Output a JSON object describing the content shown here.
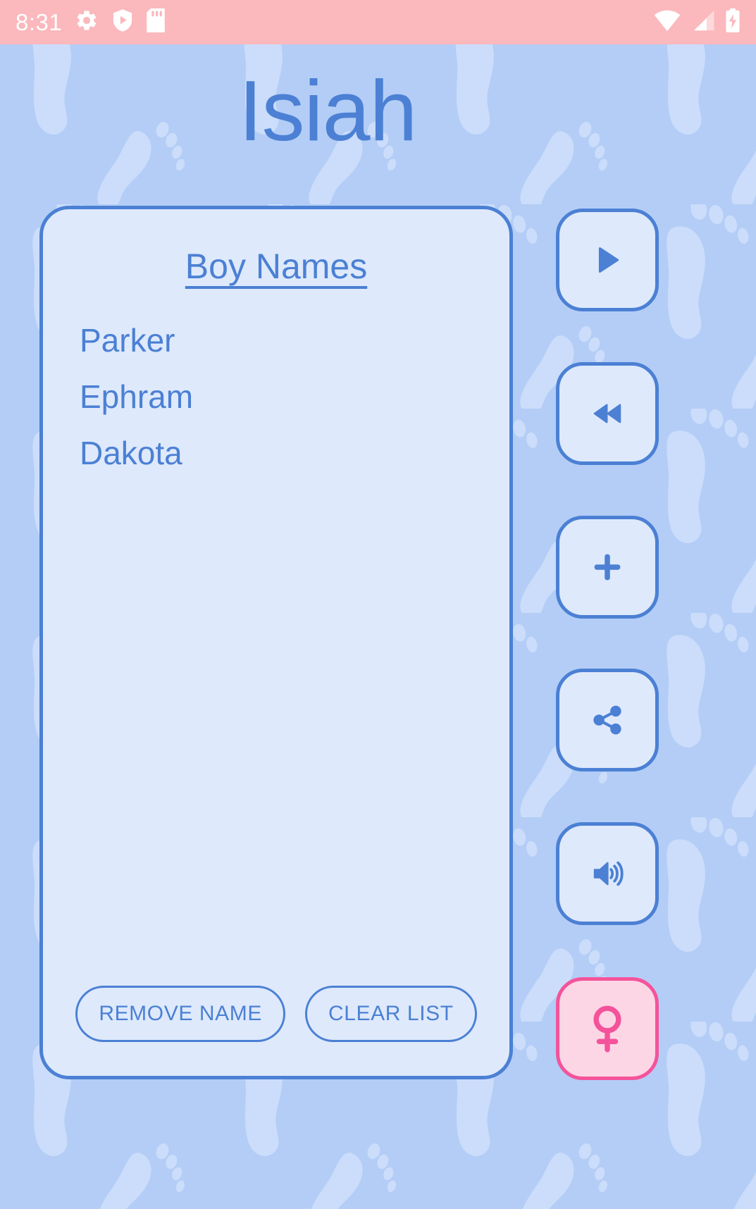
{
  "status_bar": {
    "time": "8:31",
    "left_icons": [
      "gear-icon",
      "play-protect-shield-icon",
      "sd-card-icon"
    ],
    "right_icons": [
      "wifi-icon",
      "cellular-signal-icon",
      "battery-charging-icon"
    ],
    "background_color": "#fbb8bd",
    "icon_color": "#ffffff"
  },
  "app": {
    "title": "Isiah",
    "background_color": "#b3cdf6",
    "accent_color": "#4b80d4",
    "card_color": "#dee9fb",
    "gender_accent_color": "#f4539b",
    "gender_fill_color": "#fcd6e4"
  },
  "names_card": {
    "heading": "Boy Names",
    "names": [
      "Parker",
      "Ephram",
      "Dakota"
    ],
    "actions": [
      {
        "label": "REMOVE NAME",
        "name": "remove-name-button"
      },
      {
        "label": "CLEAR LIST",
        "name": "clear-list-button"
      }
    ]
  },
  "side_rail": {
    "buttons": [
      {
        "icon": "play-icon",
        "name": "play-button"
      },
      {
        "icon": "rewind-icon",
        "name": "rewind-button"
      },
      {
        "icon": "plus-icon",
        "name": "add-name-button"
      },
      {
        "icon": "share-icon",
        "name": "share-button"
      },
      {
        "icon": "volume-icon",
        "name": "volume-button"
      },
      {
        "icon": "female-gender-icon",
        "name": "gender-toggle-button"
      }
    ]
  }
}
